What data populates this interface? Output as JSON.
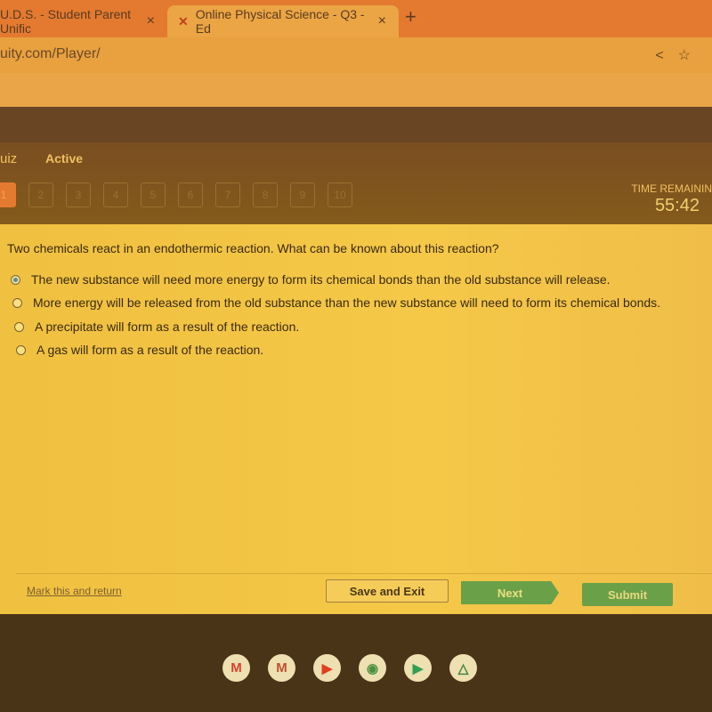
{
  "browser": {
    "tabs": [
      {
        "label": "U.D.S. - Student Parent Unific",
        "close": "×"
      },
      {
        "label": "Online Physical Science - Q3 - Ed",
        "close": "×",
        "icon": "edgenuity-x-icon"
      }
    ],
    "new_tab": "+",
    "url": "uity.com/Player/",
    "share_icon": "<",
    "star_icon": "☆"
  },
  "quiz": {
    "title": "uiz",
    "status": "Active",
    "questions": [
      "1",
      "2",
      "3",
      "4",
      "5",
      "6",
      "7",
      "8",
      "9",
      "10"
    ],
    "current": 1,
    "time_label": "TIME REMAININ",
    "time": "55:42"
  },
  "question": {
    "text": "Two chemicals react in an endothermic reaction. What can be known about this reaction?",
    "options": [
      "The new substance will need more energy to form its chemical bonds than the old substance will release.",
      "More energy will be released from the old substance than the new substance will need to form its chemical bonds.",
      "A precipitate will form as a result of the reaction.",
      "A gas will form as a result of the reaction."
    ],
    "selected": 0
  },
  "footer": {
    "mark": "Mark this and return",
    "save": "Save and Exit",
    "next": "Next",
    "submit": "Submit"
  },
  "shelf": [
    {
      "name": "gmail-icon",
      "glyph": "M",
      "color": "#d84030"
    },
    {
      "name": "app-m-icon",
      "glyph": "M",
      "color": "#c05030"
    },
    {
      "name": "youtube-icon",
      "glyph": "▶",
      "color": "#e04020"
    },
    {
      "name": "chrome-icon",
      "glyph": "◉",
      "color": "#4a9040"
    },
    {
      "name": "play-store-icon",
      "glyph": "▶",
      "color": "#30a050"
    },
    {
      "name": "drive-icon",
      "glyph": "△",
      "color": "#3a8040"
    }
  ]
}
